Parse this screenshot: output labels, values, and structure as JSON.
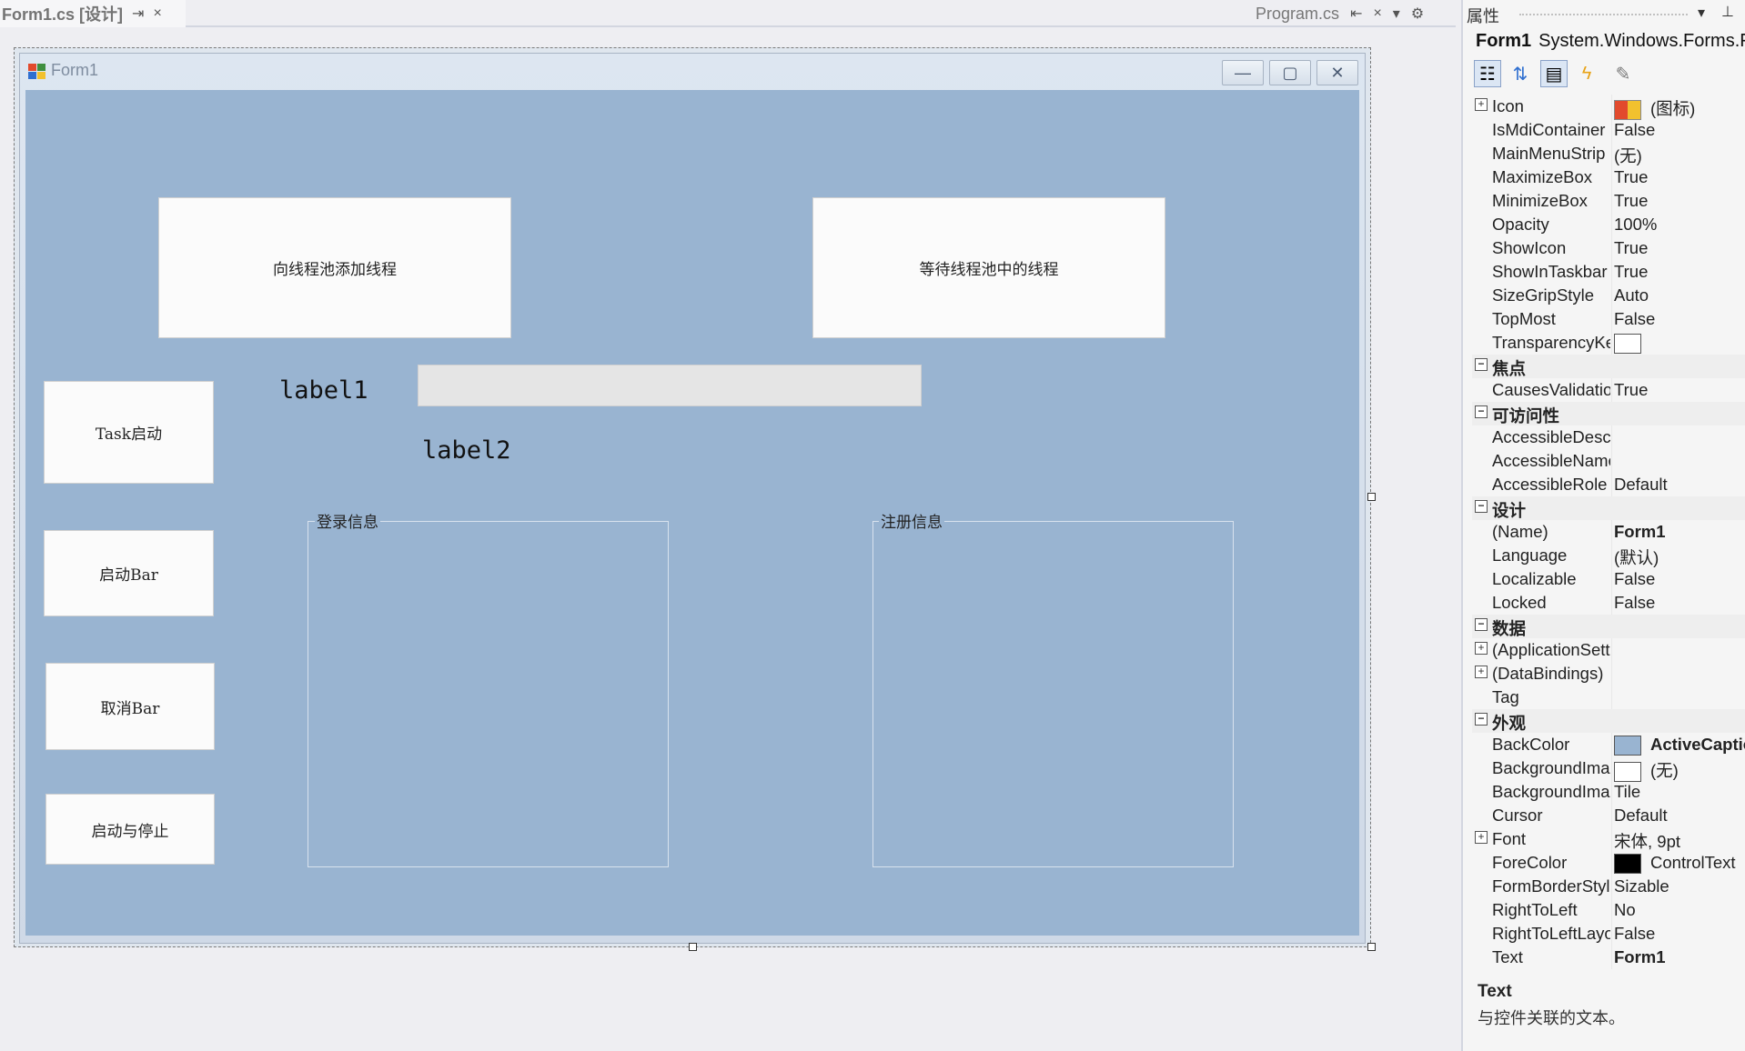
{
  "tabs": {
    "active": "Form1.cs [设计]",
    "pin_icon": "pin-icon",
    "close_icon": "×",
    "secondary": "Program.cs",
    "dropdown_icon": "▾",
    "settings_icon": "⚙"
  },
  "form": {
    "title": "Form1",
    "caption_buttons": {
      "minimize": "—",
      "maximize": "▢",
      "close": "✕"
    },
    "buttons": {
      "add_thread": "向线程池添加线程",
      "wait_thread": "等待线程池中的线程",
      "task_start": "Task启动",
      "start_bar": "启动Bar",
      "cancel_bar": "取消Bar",
      "start_stop": "启动与停止"
    },
    "labels": {
      "label1": "label1",
      "label2": "label2"
    },
    "groups": {
      "login": "登录信息",
      "register": "注册信息"
    },
    "backcolor": "#99b4d1"
  },
  "properties": {
    "header": "属性",
    "object_name": "Form1",
    "object_type": "System.Windows.Forms.Form",
    "rows": [
      {
        "name": "Icon",
        "value": "(图标)",
        "expand": "+",
        "swatch": "icon"
      },
      {
        "name": "IsMdiContainer",
        "value": "False"
      },
      {
        "name": "MainMenuStrip",
        "value": "(无)"
      },
      {
        "name": "MaximizeBox",
        "value": "True"
      },
      {
        "name": "MinimizeBox",
        "value": "True"
      },
      {
        "name": "Opacity",
        "value": "100%"
      },
      {
        "name": "ShowIcon",
        "value": "True"
      },
      {
        "name": "ShowInTaskbar",
        "value": "True"
      },
      {
        "name": "SizeGripStyle",
        "value": "Auto"
      },
      {
        "name": "TopMost",
        "value": "False"
      },
      {
        "name": "TransparencyKey",
        "value": "",
        "swatch": "#ffffff"
      },
      {
        "category": "焦点",
        "expand": "−"
      },
      {
        "name": "CausesValidation",
        "value": "True"
      },
      {
        "category": "可访问性",
        "expand": "−"
      },
      {
        "name": "AccessibleDescription",
        "value": ""
      },
      {
        "name": "AccessibleName",
        "value": ""
      },
      {
        "name": "AccessibleRole",
        "value": "Default"
      },
      {
        "category": "设计",
        "expand": "−"
      },
      {
        "name": "(Name)",
        "value": "Form1",
        "bold": true
      },
      {
        "name": "Language",
        "value": "(默认)"
      },
      {
        "name": "Localizable",
        "value": "False"
      },
      {
        "name": "Locked",
        "value": "False"
      },
      {
        "category": "数据",
        "expand": "−"
      },
      {
        "name": "(ApplicationSettings)",
        "value": "",
        "expand": "+"
      },
      {
        "name": "(DataBindings)",
        "value": "",
        "expand": "+"
      },
      {
        "name": "Tag",
        "value": ""
      },
      {
        "category": "外观",
        "expand": "−"
      },
      {
        "name": "BackColor",
        "value": "ActiveCaption",
        "swatch": "#99b4d1",
        "bold": true
      },
      {
        "name": "BackgroundImage",
        "value": "(无)",
        "swatch": "#ffffff"
      },
      {
        "name": "BackgroundImageLayout",
        "value": "Tile"
      },
      {
        "name": "Cursor",
        "value": "Default"
      },
      {
        "name": "Font",
        "value": "宋体, 9pt",
        "expand": "+"
      },
      {
        "name": "ForeColor",
        "value": "ControlText",
        "swatch": "#000000"
      },
      {
        "name": "FormBorderStyle",
        "value": "Sizable"
      },
      {
        "name": "RightToLeft",
        "value": "No"
      },
      {
        "name": "RightToLeftLayout",
        "value": "False"
      },
      {
        "name": "Text",
        "value": "Form1",
        "bold": true
      }
    ],
    "desc_title": "Text",
    "desc_text": "与控件关联的文本。"
  }
}
